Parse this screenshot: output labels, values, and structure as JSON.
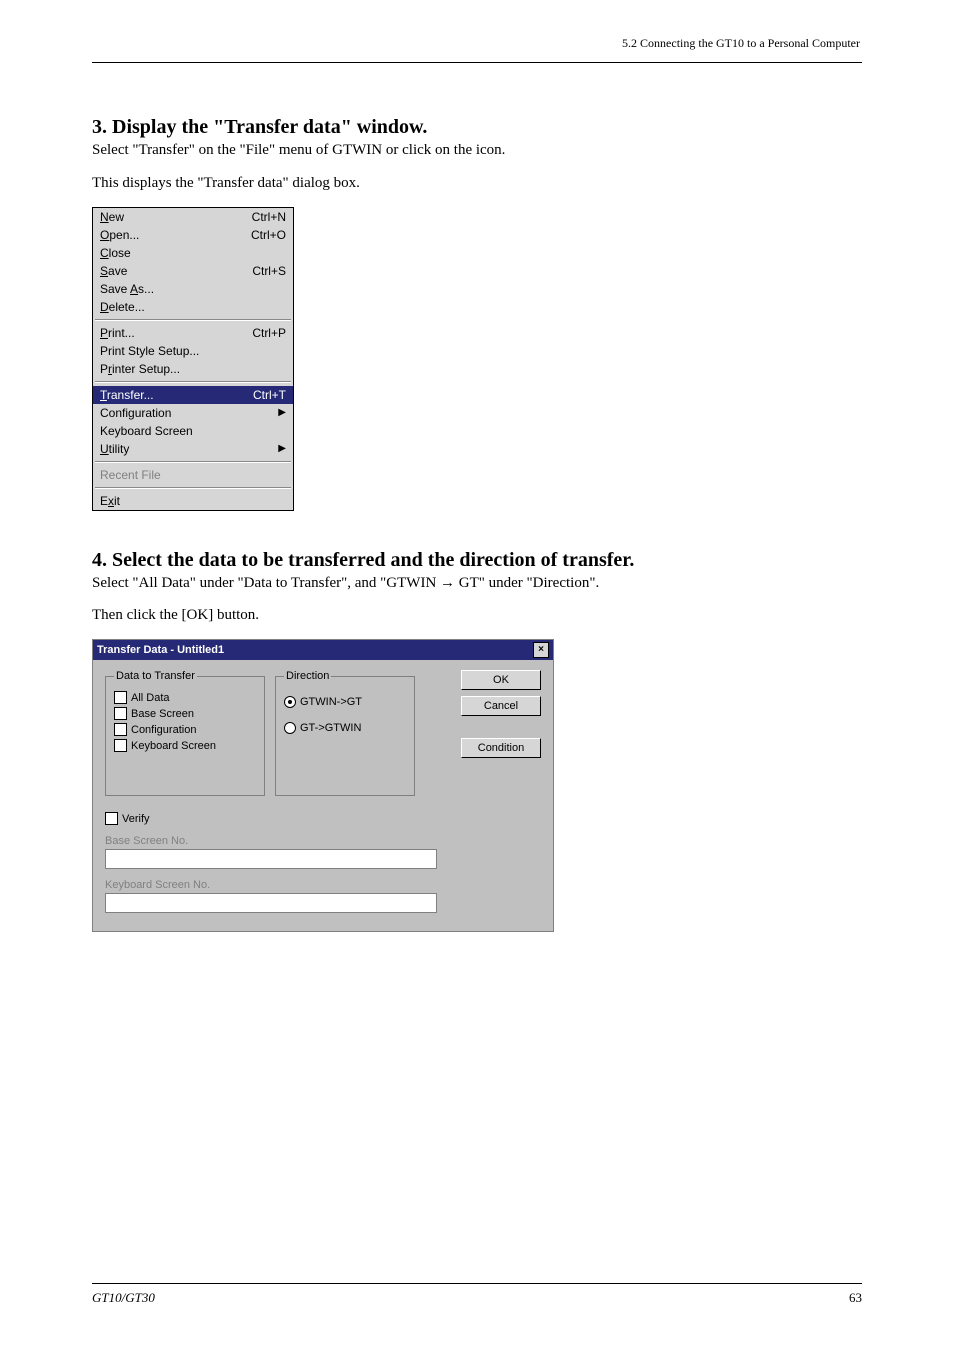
{
  "header": {
    "right": "5.2 Connecting the GT10 to a Personal Computer"
  },
  "section1": {
    "heading": "3. Display the \"Transfer data\" window.",
    "p1": "Select \"Transfer\" on the \"File\" menu of GTWIN or click on the  icon.",
    "p2": "This displays the \"Transfer data\" dialog box."
  },
  "filemenu": {
    "new": "New",
    "newSc": "Ctrl+N",
    "open": "Open...",
    "openSc": "Ctrl+O",
    "close": "Close",
    "save": "Save",
    "saveSc": "Ctrl+S",
    "saveAs": "Save As...",
    "delete": "Delete...",
    "print": "Print...",
    "printSc": "Ctrl+P",
    "printStyle": "Print Style Setup...",
    "printerSetup": "Printer Setup...",
    "transfer": "Transfer...",
    "transferSc": "Ctrl+T",
    "configuration": "Configuration",
    "keyboardScreen": "Keyboard Screen",
    "utility": "Utility",
    "recent": "Recent File",
    "exit": "Exit"
  },
  "section2": {
    "heading": "4. Select the data to be transferred and the direction of transfer.",
    "p1": "Select \"All Data\" under \"Data to Transfer\", and \"GTWIN → GT\" under \"Direction\".",
    "p2": "Then click the [OK] button."
  },
  "dialog": {
    "title": "Transfer Data - Untitled1",
    "closeGlyph": "×",
    "grpData": "Data to Transfer",
    "chkAll": "All Data",
    "chkBase": "Base Screen",
    "chkConfig": "Configuration",
    "chkKeyboard": "Keyboard Screen",
    "grpDir": "Direction",
    "radToGT": "GTWIN->GT",
    "radToWIN": "GT->GTWIN",
    "ok": "OK",
    "cancel": "Cancel",
    "condition": "Condition",
    "verify": "Verify",
    "baseNo": "Base Screen No.",
    "keyNo": "Keyboard Screen No."
  },
  "footer": {
    "left": "GT10/GT30",
    "page": "63"
  }
}
